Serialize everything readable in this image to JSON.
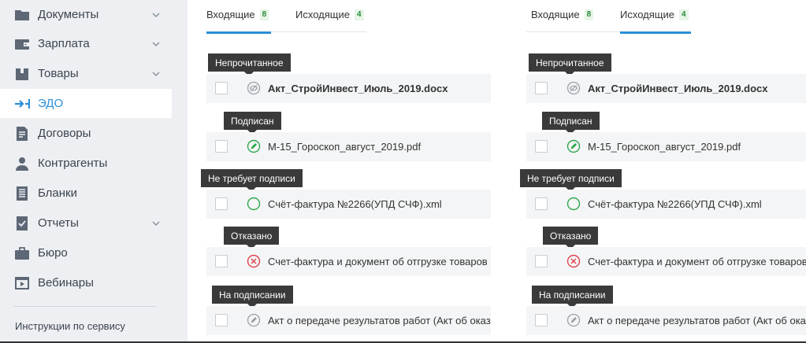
{
  "sidebar": {
    "items": [
      {
        "label": "Документы",
        "icon": "folder-icon",
        "has_chevron": true
      },
      {
        "label": "Зарплата",
        "icon": "wallet-icon",
        "has_chevron": true
      },
      {
        "label": "Товары",
        "icon": "box-icon",
        "has_chevron": true
      },
      {
        "label": "ЭДО",
        "icon": "edo-exchange-icon",
        "has_chevron": false,
        "active": true
      },
      {
        "label": "Договоры",
        "icon": "contract-icon",
        "has_chevron": false
      },
      {
        "label": "Контрагенты",
        "icon": "person-icon",
        "has_chevron": false
      },
      {
        "label": "Бланки",
        "icon": "form-icon",
        "has_chevron": false
      },
      {
        "label": "Отчеты",
        "icon": "report-check-icon",
        "has_chevron": true
      },
      {
        "label": "Бюро",
        "icon": "briefcase-icon",
        "has_chevron": false
      },
      {
        "label": "Вебинары",
        "icon": "video-icon",
        "has_chevron": false
      }
    ],
    "footer_link": "Инструкции по сервису"
  },
  "panels": [
    {
      "tabs": [
        {
          "label": "Входящие",
          "count": "8",
          "active": true
        },
        {
          "label": "Исходящие",
          "count": "4",
          "active": false
        }
      ],
      "documents": [
        {
          "status": "Непрочитанное",
          "status_icon": "unread-eye-icon",
          "name": "Акт_СтройИнвест_Июль_2019.docx",
          "bold": true
        },
        {
          "status": "Подписан",
          "status_icon": "signed-pen-icon",
          "name": "М-15_Гороскоп_август_2019.pdf",
          "bold": false
        },
        {
          "status": "Не требует подписи",
          "status_icon": "no-sign-circle-icon",
          "name": "Счёт-фактура №2266(УПД СЧФ).xml",
          "bold": false
        },
        {
          "status": "Отказано",
          "status_icon": "rejected-x-icon",
          "name": "Счет-фактура и документ об отгрузке товаров",
          "bold": false
        },
        {
          "status": "На подписании",
          "status_icon": "signing-pen-icon",
          "name": "Акт о передаче результатов работ (Акт об оказании услуг)",
          "bold": false
        }
      ]
    },
    {
      "tabs": [
        {
          "label": "Входящие",
          "count": "8",
          "active": false
        },
        {
          "label": "Исходящие",
          "count": "4",
          "active": true
        }
      ],
      "documents": [
        {
          "status": "Непрочитанное",
          "status_icon": "unread-eye-icon",
          "name": "Акт_СтройИнвест_Июль_2019.docx",
          "bold": true
        },
        {
          "status": "Подписан",
          "status_icon": "signed-pen-icon",
          "name": "М-15_Гороскоп_август_2019.pdf",
          "bold": false
        },
        {
          "status": "Не требует подписи",
          "status_icon": "no-sign-circle-icon",
          "name": "Счёт-фактура №2266(УПД СЧФ).xml",
          "bold": false
        },
        {
          "status": "Отказано",
          "status_icon": "rejected-x-icon",
          "name": "Счет-фактура и документ об отгрузке товаров",
          "bold": false
        },
        {
          "status": "На подписании",
          "status_icon": "signing-pen-icon",
          "name": "Акт о передаче результатов работ (Акт об оказании услуг)",
          "bold": false
        }
      ]
    }
  ],
  "colors": {
    "accent": "#2a8fd6",
    "sidebar_bg": "#edeff2",
    "tooltip_bg": "#3a3a3a",
    "signed_green": "#2fa84f",
    "rejected_red": "#e0454f",
    "count_green": "#2b8a3e"
  }
}
